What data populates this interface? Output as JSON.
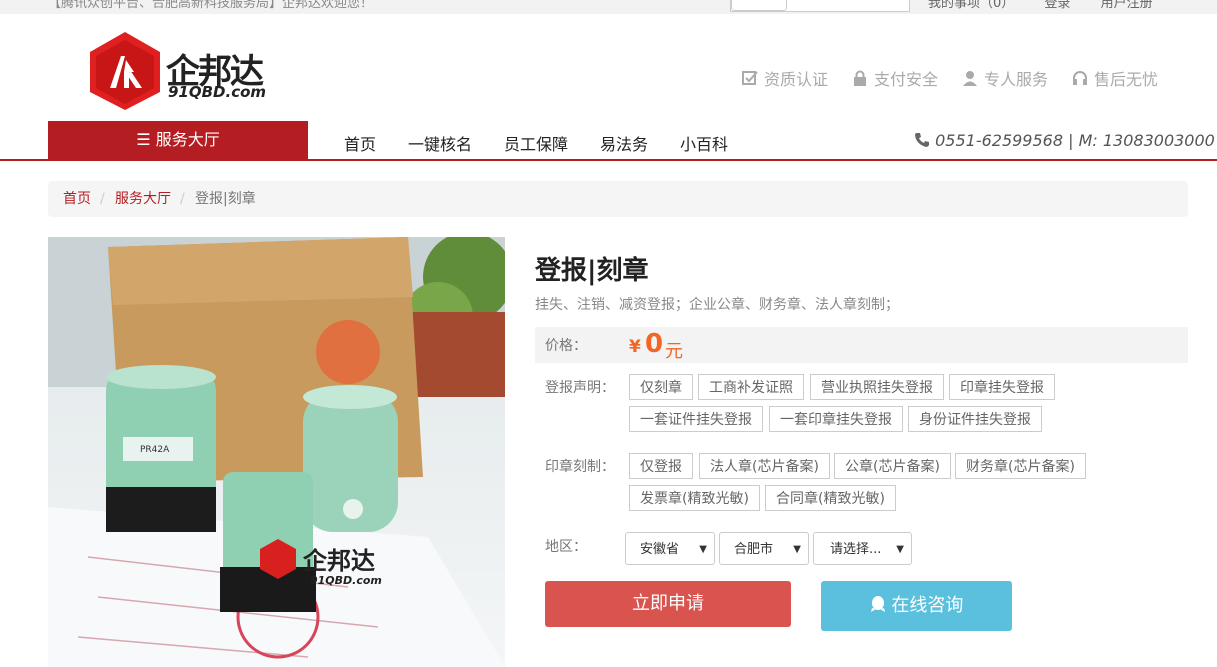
{
  "topbar": {
    "notice": "【腾讯众创平台、合肥高新科技服务局】企邦达欢迎您！",
    "links": [
      "我的事项（0）",
      "登录",
      "用户注册"
    ]
  },
  "logo": {
    "brand": "企邦达",
    "domain": "91QBD.com"
  },
  "assurances": [
    "资质认证",
    "支付安全",
    "专人服务",
    "售后无忧"
  ],
  "nav": {
    "service_hall": "服务大厅",
    "items": [
      "首页",
      "一键核名",
      "员工保障",
      "易法务",
      "小百科"
    ],
    "phone": "0551-62599568 | M: 13083003000"
  },
  "breadcrumb": [
    "首页",
    "服务大厅",
    "登报|刻章"
  ],
  "product": {
    "title": "登报|刻章",
    "desc": "挂失、注销、减资登报；企业公章、财务章、法人章刻制；",
    "price_label": "价格：",
    "currency": "¥",
    "price": "0",
    "unit": "元",
    "notice_label": "登报声明：",
    "notice_options": [
      "仅刻章",
      "工商补发证照",
      "营业执照挂失登报",
      "印章挂失登报",
      "一套证件挂失登报",
      "一套印章挂失登报",
      "身份证件挂失登报"
    ],
    "seal_label": "印章刻制：",
    "seal_options": [
      "仅登报",
      "法人章(芯片备案)",
      "公章(芯片备案)",
      "财务章(芯片备案)",
      "发票章(精致光敏)",
      "合同章(精致光敏)"
    ],
    "region_label": "地区：",
    "region": {
      "province": "安徽省",
      "city": "合肥市",
      "district": "请选择..."
    },
    "apply_button": "立即申请",
    "chat_button": "在线咨询"
  },
  "photo": {
    "stamp_label": "PR42A",
    "watermark_brand": "企邦达",
    "watermark_domain": "91QBD.com"
  },
  "colors": {
    "brand_red": "#b41e22",
    "price_orange": "#f26522",
    "apply_red": "#d9534f",
    "chat_blue": "#5bc0de"
  }
}
